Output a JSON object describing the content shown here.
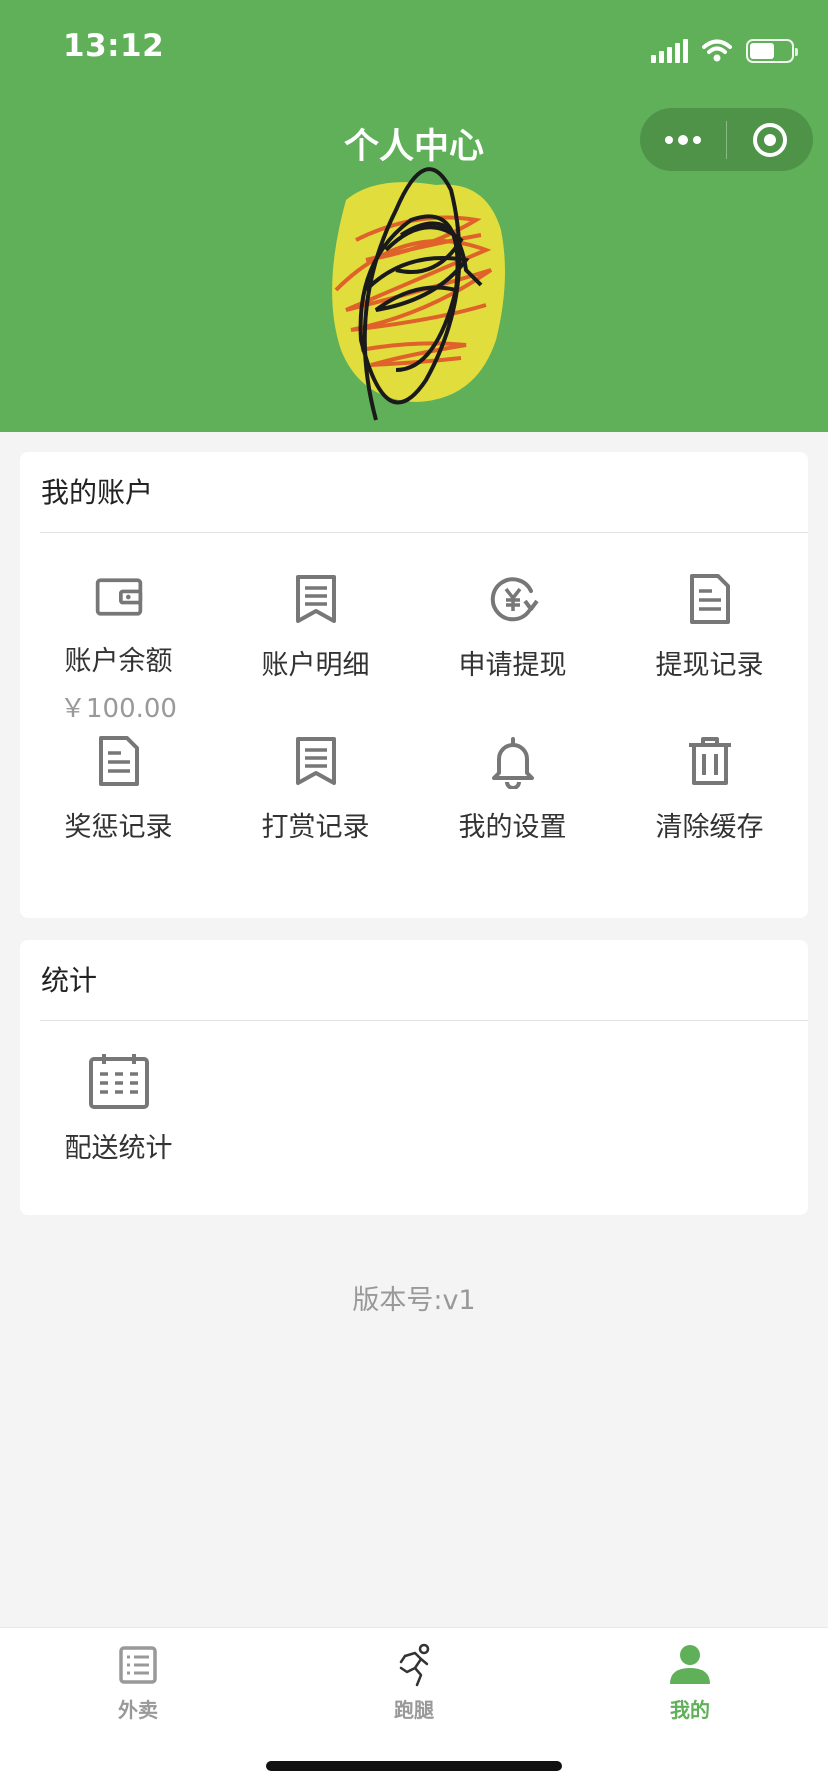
{
  "status_bar": {
    "time": "13:12",
    "battery_level": 0.6
  },
  "header": {
    "title": "个人中心"
  },
  "account": {
    "title": "我的账户",
    "items": [
      {
        "label": "账户余额",
        "value": "￥100.00",
        "icon": "wallet-icon"
      },
      {
        "label": "账户明细",
        "icon": "receipt-icon"
      },
      {
        "label": "申请提现",
        "icon": "yuan-withdraw-icon"
      },
      {
        "label": "提现记录",
        "icon": "document-icon"
      },
      {
        "label": "奖惩记录",
        "icon": "document-icon"
      },
      {
        "label": "打赏记录",
        "icon": "receipt-icon"
      },
      {
        "label": "我的设置",
        "icon": "bell-icon"
      },
      {
        "label": "清除缓存",
        "icon": "trash-icon"
      }
    ]
  },
  "stats": {
    "title": "统计",
    "items": [
      {
        "label": "配送统计",
        "icon": "calendar-icon"
      }
    ]
  },
  "version": "版本号:v1",
  "tabbar": {
    "items": [
      {
        "label": "外卖",
        "icon": "list-icon",
        "active": false
      },
      {
        "label": "跑腿",
        "icon": "runner-icon",
        "active": false
      },
      {
        "label": "我的",
        "icon": "user-icon",
        "active": true
      }
    ]
  },
  "colors": {
    "brand": "#5fb058",
    "icon_gray": "#777777",
    "muted_text": "#999999"
  }
}
